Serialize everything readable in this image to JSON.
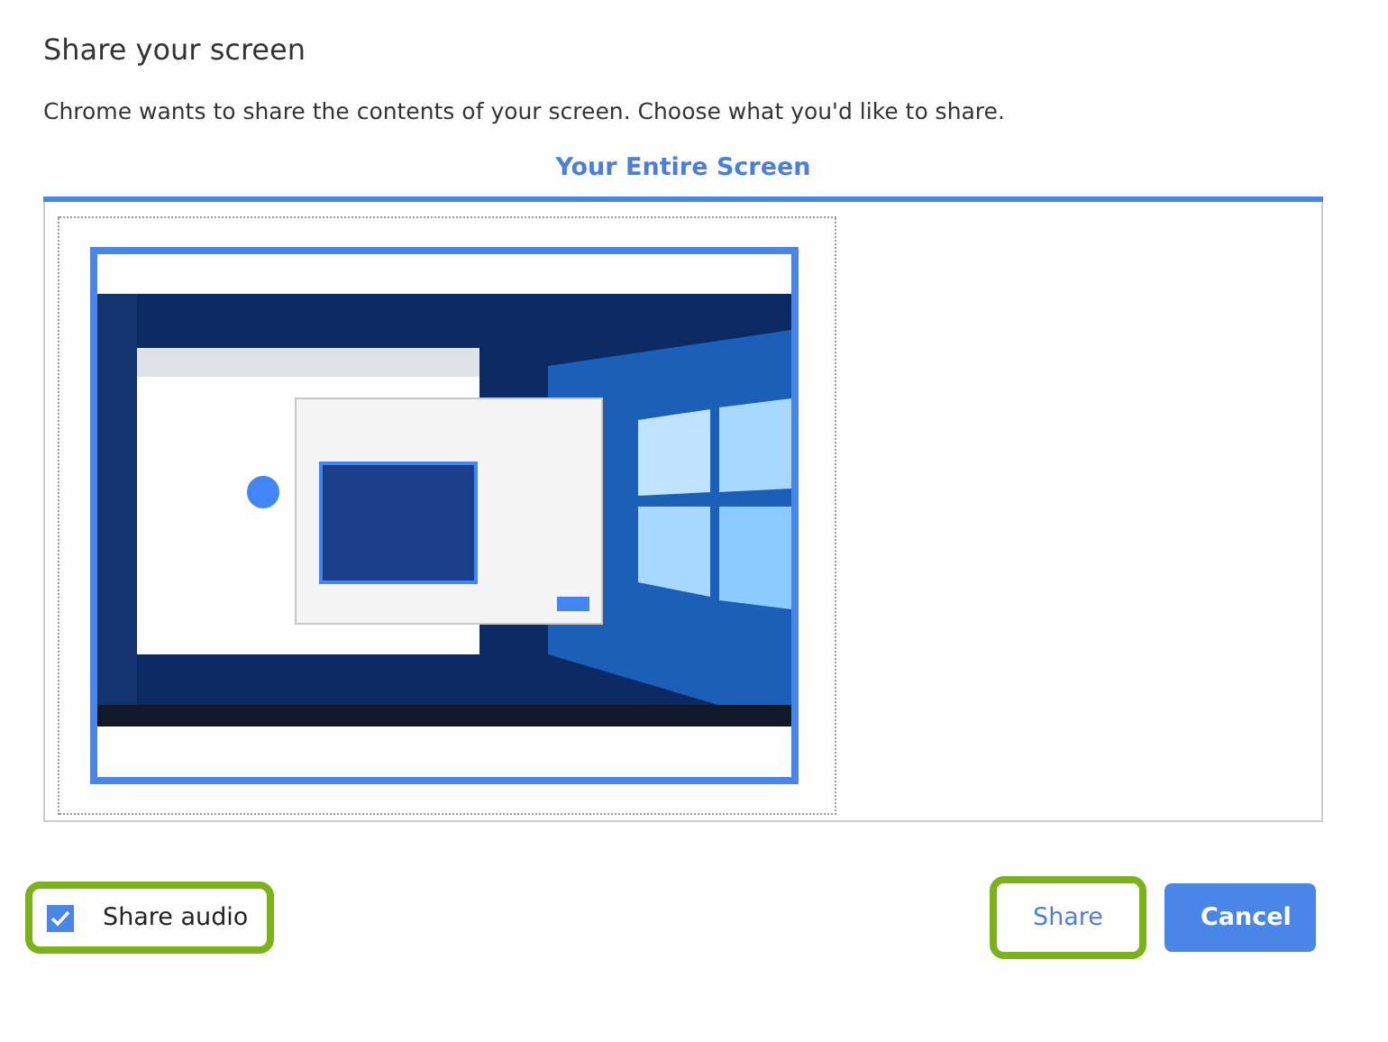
{
  "dialog": {
    "title": "Share your screen",
    "message": "Chrome wants to share the contents of your screen. Choose what you'd like to share."
  },
  "tabs": [
    {
      "label": "Your Entire Screen",
      "selected": true
    }
  ],
  "sources": [
    {
      "kind": "picture",
      "selected": true
    }
  ],
  "share_audio": {
    "label": "Share audio",
    "checked": true,
    "highlighted": true
  },
  "buttons": [
    {
      "label": "Share",
      "kind": "secondary",
      "highlighted": true
    },
    {
      "label": "Cancel",
      "kind": "primary",
      "highlighted": false
    }
  ]
}
